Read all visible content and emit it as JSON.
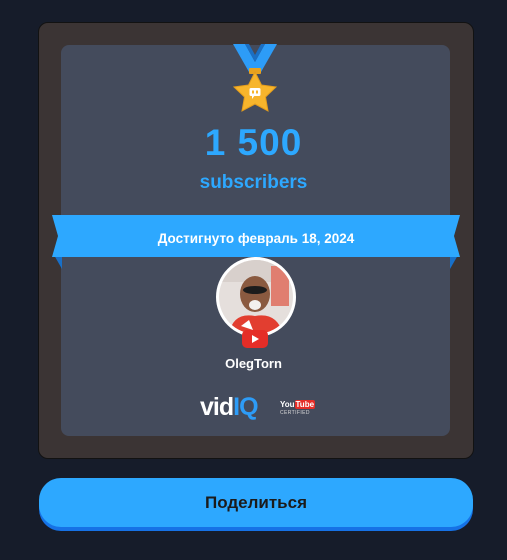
{
  "milestone": {
    "count": "1 500",
    "unit_label": "subscribers",
    "achieved_text": "Достигнуто февраль 18, 2024"
  },
  "channel": {
    "name": "OlegTorn"
  },
  "branding": {
    "vidiq_logo_text_a": "vid",
    "vidiq_logo_text_b": "IQ",
    "youtube_badge_text_a": "You",
    "youtube_badge_text_b": "Tube",
    "certified_text": "CERTIFIED"
  },
  "actions": {
    "share_label": "Поделиться"
  },
  "colors": {
    "accent": "#2da8ff",
    "card_bg": "#444b5c",
    "page_bg": "#161c2a",
    "medal_gold": "#f7b52c",
    "youtube_red": "#e52d27"
  },
  "icons": [
    "medal-star-icon",
    "youtube-play-icon"
  ]
}
